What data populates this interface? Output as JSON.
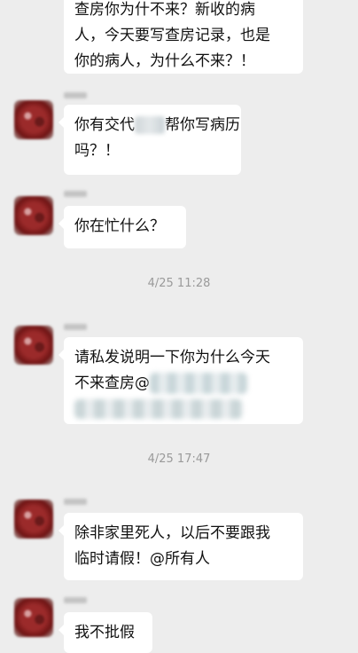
{
  "messages": [
    {
      "lines": [
        "查房你为什不来？新收的病",
        "人，今天要写查房记录，也是",
        "你的病人，为什么不来？！"
      ]
    },
    {
      "lines": [
        "你有交代",
        "帮你写病历",
        "吗？！"
      ]
    },
    {
      "lines": [
        "你在忙什么？"
      ]
    },
    {
      "lines": [
        "请私发说明一下你为什么今天",
        "不来查房@"
      ]
    },
    {
      "lines": [
        "除非家里死人，以后不要跟我",
        "临时请假！@所有人"
      ]
    },
    {
      "lines": [
        "我不批假"
      ]
    }
  ],
  "timestamps": [
    "4/25 11:28",
    "4/25 17:47"
  ]
}
